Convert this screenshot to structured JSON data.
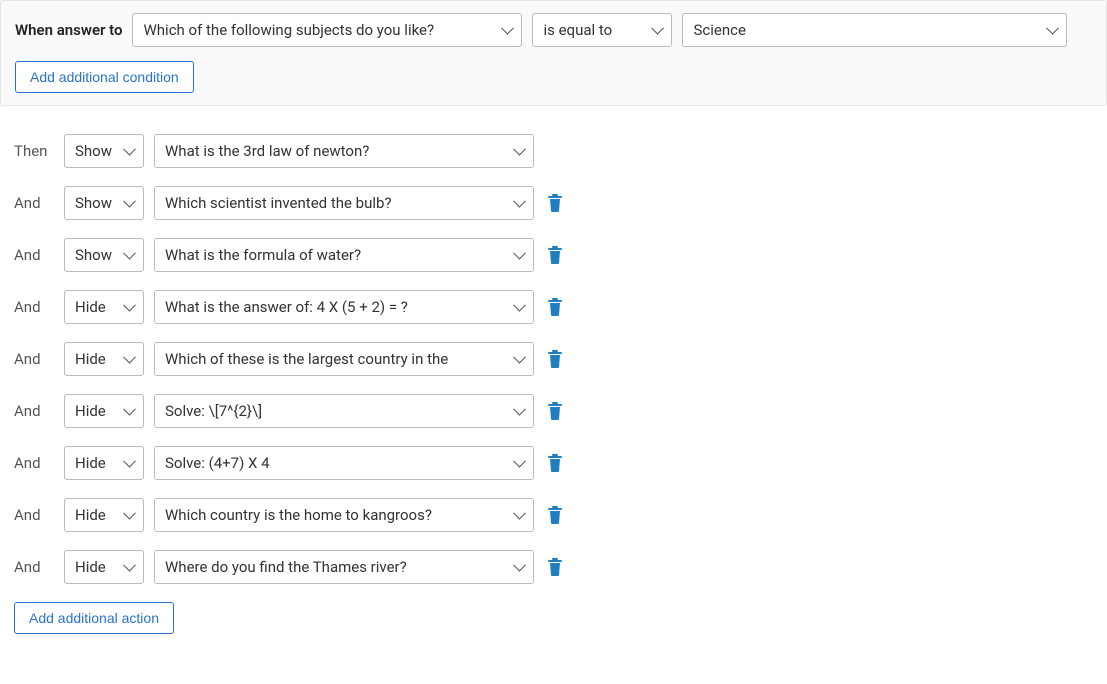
{
  "condition": {
    "when_label": "When answer to",
    "question": "Which of the following subjects do you like?",
    "operator": "is equal to",
    "value": "Science",
    "add_condition": "Add additional condition"
  },
  "actions": {
    "rows": [
      {
        "prefix": "Then",
        "act": "Show",
        "target": "What is the 3rd law of newton?",
        "deletable": false
      },
      {
        "prefix": "And",
        "act": "Show",
        "target": "Which scientist invented the bulb?",
        "deletable": true
      },
      {
        "prefix": "And",
        "act": "Show",
        "target": "What is the formula of water?",
        "deletable": true
      },
      {
        "prefix": "And",
        "act": "Hide",
        "target": "What is the answer of: 4 X (5 + 2) = ?",
        "deletable": true
      },
      {
        "prefix": "And",
        "act": "Hide",
        "target": "Which of these is the largest country in the",
        "deletable": true
      },
      {
        "prefix": "And",
        "act": "Hide",
        "target": "Solve: \\[7^{2}\\]",
        "deletable": true
      },
      {
        "prefix": "And",
        "act": "Hide",
        "target": "Solve: (4+7) X 4",
        "deletable": true
      },
      {
        "prefix": "And",
        "act": "Hide",
        "target": "Which country is the home to kangroos?",
        "deletable": true
      },
      {
        "prefix": "And",
        "act": "Hide",
        "target": "Where do you find the Thames river?",
        "deletable": true
      }
    ],
    "add_action": "Add additional action"
  }
}
